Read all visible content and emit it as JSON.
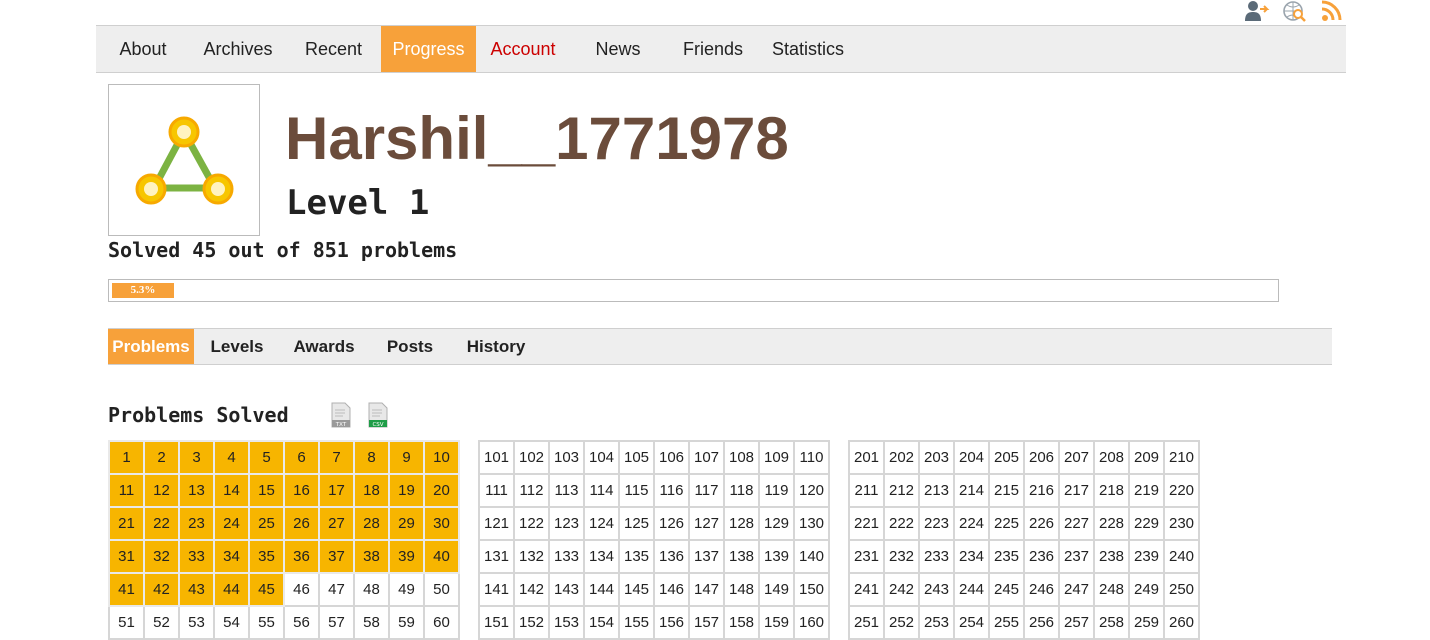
{
  "header_icons": [
    "account-arrow-icon",
    "globe-search-icon",
    "rss-feed-icon"
  ],
  "nav": {
    "items": [
      {
        "label": "About"
      },
      {
        "label": "Archives"
      },
      {
        "label": "Recent"
      },
      {
        "label": "Progress",
        "active": true
      },
      {
        "label": "Account",
        "highlight": "#cc0000"
      },
      {
        "label": "News"
      },
      {
        "label": "Friends"
      },
      {
        "label": "Statistics"
      }
    ]
  },
  "profile": {
    "avatar_icon": "network-triangle-icon",
    "username": "Harshil__1771978",
    "level": "Level 1",
    "solved_text": "Solved 45 out of 851 problems",
    "progress_percent": 5.3,
    "progress_label": "5.3%"
  },
  "tabs": {
    "items": [
      {
        "label": "Problems",
        "active": true
      },
      {
        "label": "Levels"
      },
      {
        "label": "Awards"
      },
      {
        "label": "Posts"
      },
      {
        "label": "History"
      }
    ]
  },
  "problems": {
    "title": "Problems Solved",
    "download_icons": [
      {
        "icon": "txt-file-icon",
        "label": "TXT"
      },
      {
        "icon": "csv-file-icon",
        "label": "CSV"
      }
    ],
    "solved_count": 45,
    "blocks": [
      {
        "rows": [
          [
            "1",
            "2",
            "3",
            "4",
            "5",
            "6",
            "7",
            "8",
            "9",
            "10"
          ],
          [
            "11",
            "12",
            "13",
            "14",
            "15",
            "16",
            "17",
            "18",
            "19",
            "20"
          ],
          [
            "21",
            "22",
            "23",
            "24",
            "25",
            "26",
            "27",
            "28",
            "29",
            "30"
          ],
          [
            "31",
            "32",
            "33",
            "34",
            "35",
            "36",
            "37",
            "38",
            "39",
            "40"
          ],
          [
            "41",
            "42",
            "43",
            "44",
            "45",
            "46",
            "47",
            "48",
            "49",
            "50"
          ],
          [
            "51",
            "52",
            "53",
            "54",
            "55",
            "56",
            "57",
            "58",
            "59",
            "60"
          ]
        ]
      },
      {
        "rows": [
          [
            "101",
            "102",
            "103",
            "104",
            "105",
            "106",
            "107",
            "108",
            "109",
            "110"
          ],
          [
            "111",
            "112",
            "113",
            "114",
            "115",
            "116",
            "117",
            "118",
            "119",
            "120"
          ],
          [
            "121",
            "122",
            "123",
            "124",
            "125",
            "126",
            "127",
            "128",
            "129",
            "130"
          ],
          [
            "131",
            "132",
            "133",
            "134",
            "135",
            "136",
            "137",
            "138",
            "139",
            "140"
          ],
          [
            "141",
            "142",
            "143",
            "144",
            "145",
            "146",
            "147",
            "148",
            "149",
            "150"
          ],
          [
            "151",
            "152",
            "153",
            "154",
            "155",
            "156",
            "157",
            "158",
            "159",
            "160"
          ]
        ]
      },
      {
        "rows": [
          [
            "201",
            "202",
            "203",
            "204",
            "205",
            "206",
            "207",
            "208",
            "209",
            "210"
          ],
          [
            "211",
            "212",
            "213",
            "214",
            "215",
            "216",
            "217",
            "218",
            "219",
            "220"
          ],
          [
            "221",
            "222",
            "223",
            "224",
            "225",
            "226",
            "227",
            "228",
            "229",
            "230"
          ],
          [
            "231",
            "232",
            "233",
            "234",
            "235",
            "236",
            "237",
            "238",
            "239",
            "240"
          ],
          [
            "241",
            "242",
            "243",
            "244",
            "245",
            "246",
            "247",
            "248",
            "249",
            "250"
          ],
          [
            "251",
            "252",
            "253",
            "254",
            "255",
            "256",
            "257",
            "258",
            "259",
            "260"
          ]
        ]
      }
    ]
  },
  "colors": {
    "accent": "#f7a13a",
    "solved_cell": "#f7b500",
    "username": "#6b4c3b",
    "account_link": "#cc0000"
  }
}
